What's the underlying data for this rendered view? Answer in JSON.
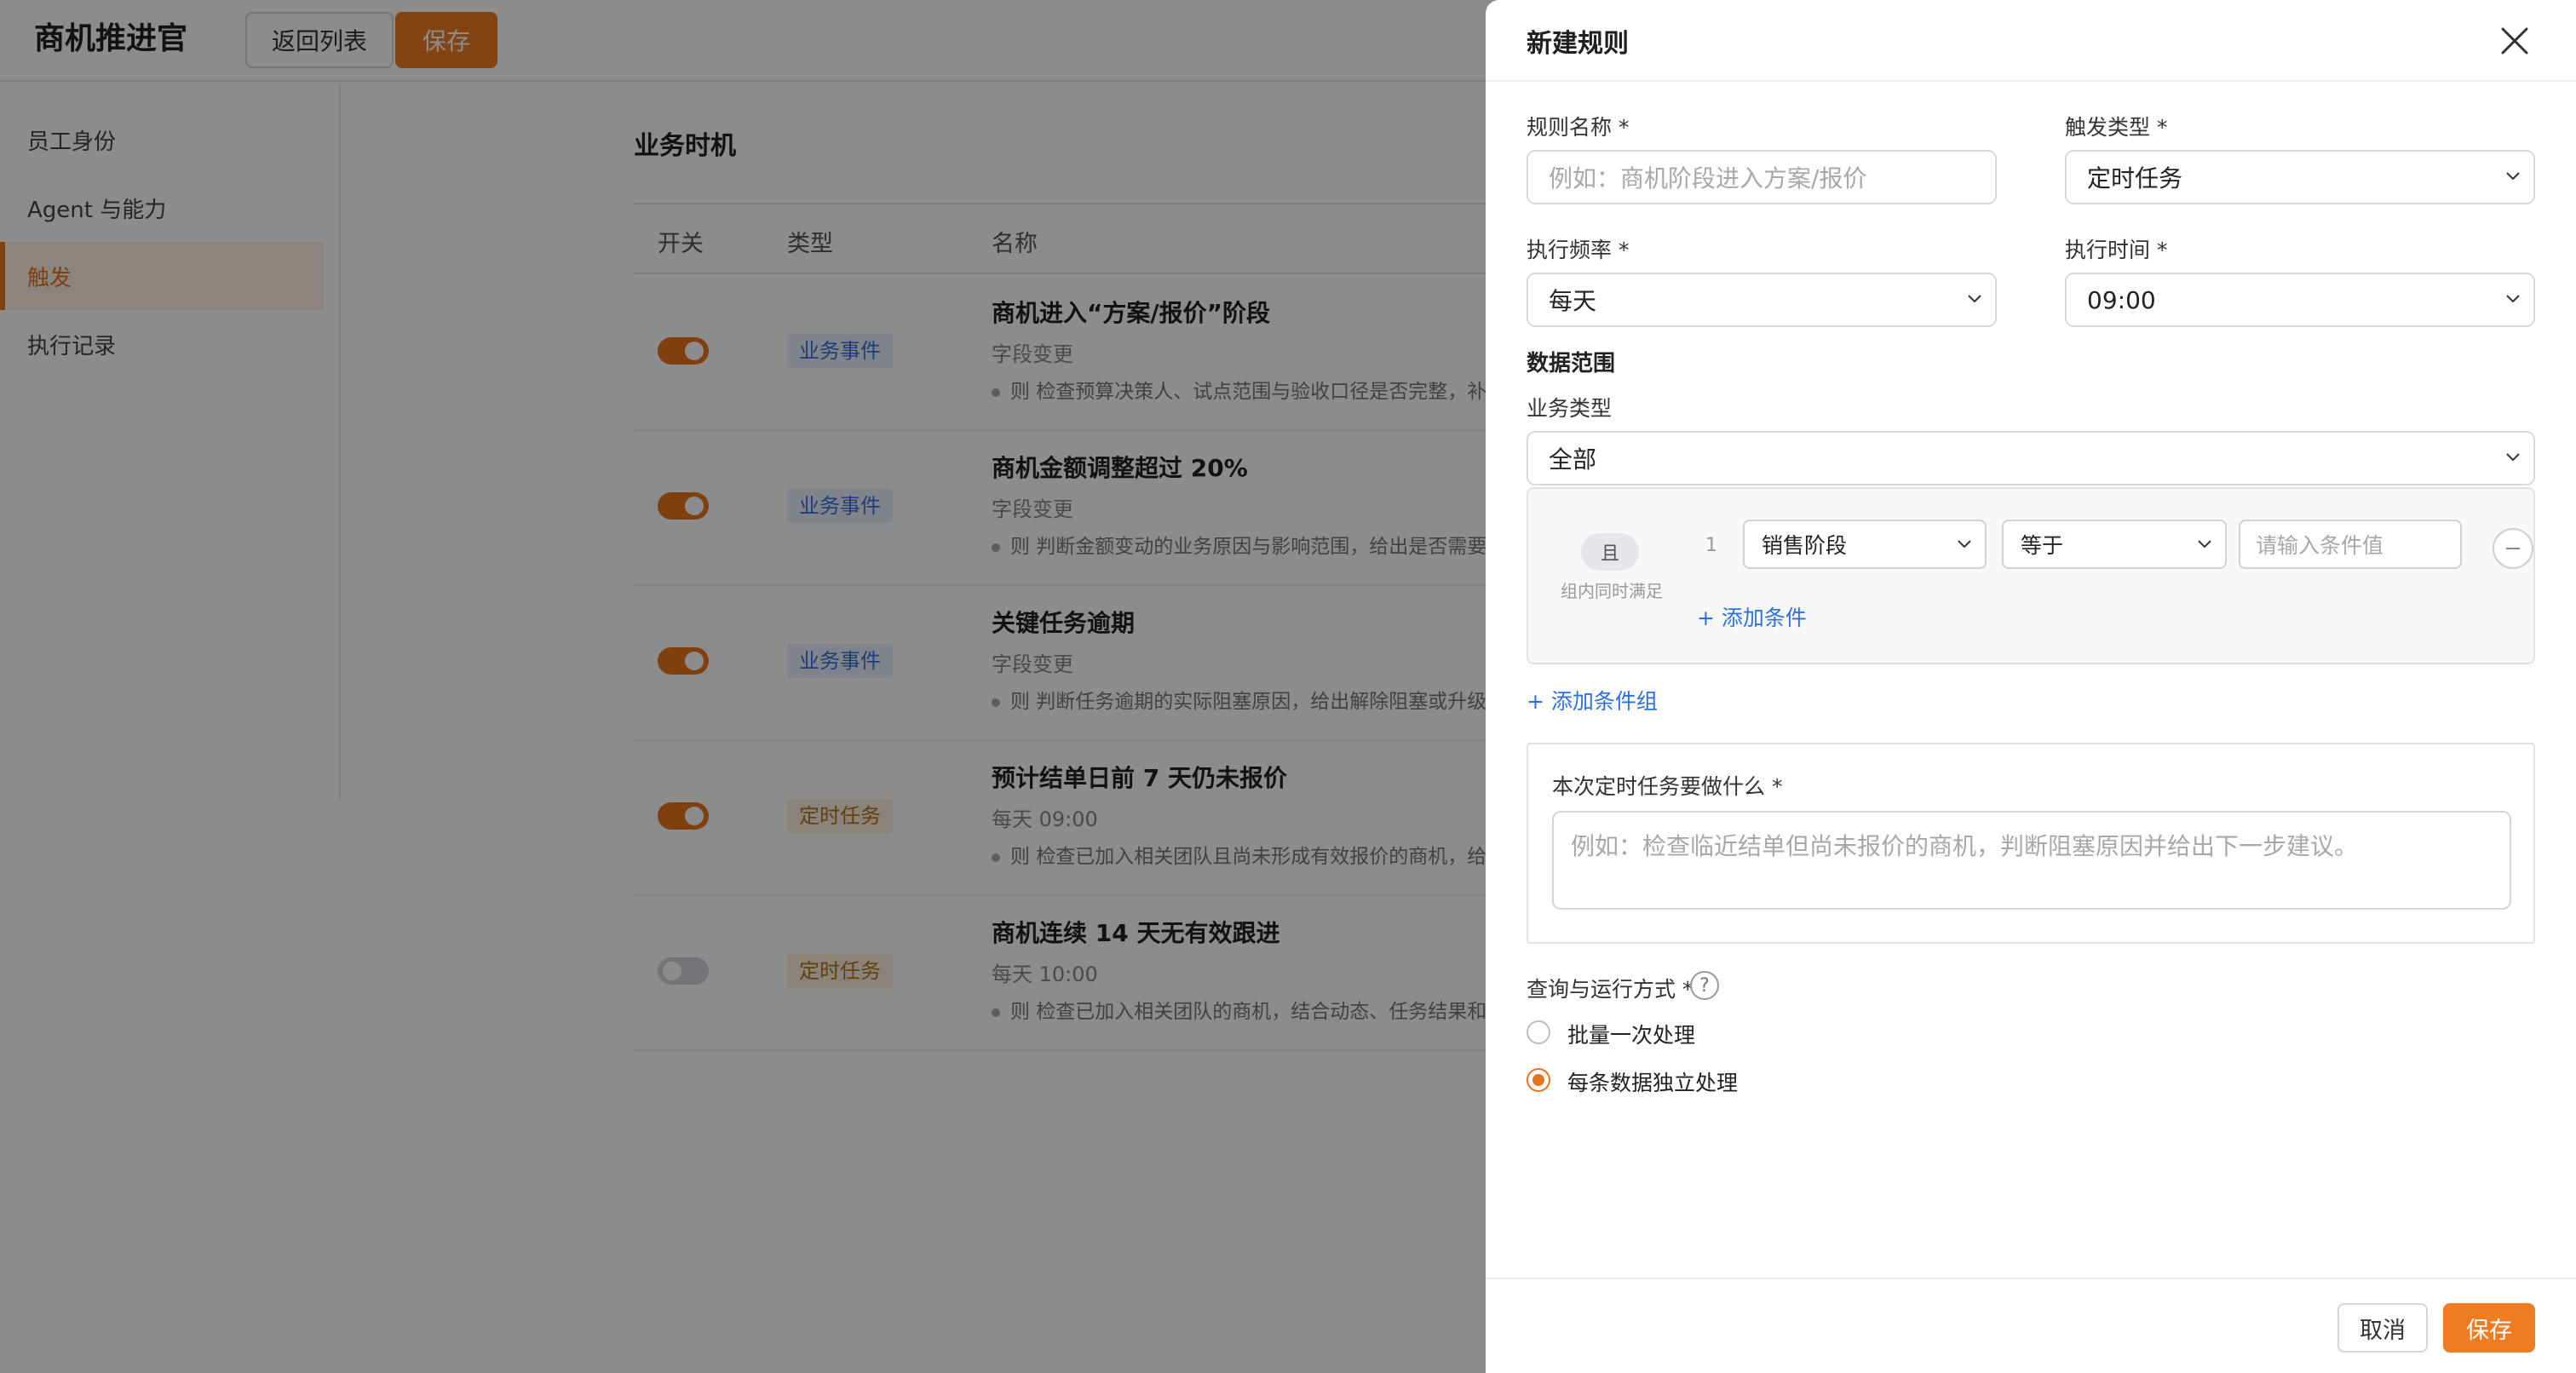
{
  "app": {
    "title": "商机推进官",
    "back_button": "返回列表",
    "save_button": "保存"
  },
  "sidebar": {
    "items": [
      {
        "label": "员工身份",
        "active": false
      },
      {
        "label": "Agent 与能力",
        "active": false
      },
      {
        "label": "触发",
        "active": true
      },
      {
        "label": "执行记录",
        "active": false
      }
    ]
  },
  "main": {
    "section_title": "业务时机",
    "columns": [
      "开关",
      "类型",
      "名称"
    ],
    "rows": [
      {
        "enabled": true,
        "type": "业务事件",
        "name": "商机进入“方案/报价”阶段",
        "sub": "字段变更",
        "desc": "则 检查预算决策人、试点范围与验收口径是否完整，补"
      },
      {
        "enabled": true,
        "type": "业务事件",
        "name": "商机金额调整超过 20%",
        "sub": "字段变更",
        "desc": "则 判断金额变动的业务原因与影响范围，给出是否需要"
      },
      {
        "enabled": true,
        "type": "业务事件",
        "name": "关键任务逾期",
        "sub": "字段变更",
        "desc": "则 判断任务逾期的实际阻塞原因，给出解除阻塞或升级"
      },
      {
        "enabled": true,
        "type": "定时任务",
        "name": "预计结单日前 7 天仍未报价",
        "sub": "每天 09:00",
        "desc": "则 检查已加入相关团队且尚未形成有效报价的商机，给"
      },
      {
        "enabled": false,
        "type": "定时任务",
        "name": "商机连续 14 天无有效跟进",
        "sub": "每天 10:00",
        "desc": "则 检查已加入相关团队的商机，结合动态、任务结果和"
      }
    ]
  },
  "drawer": {
    "title": "新建规则",
    "rule_name": {
      "label": "规则名称 *",
      "placeholder": "例如：商机阶段进入方案/报价"
    },
    "trigger_type": {
      "label": "触发类型 *",
      "value": "定时任务"
    },
    "frequency": {
      "label": "执行频率 *",
      "value": "每天"
    },
    "exec_time": {
      "label": "执行时间 *",
      "value": "09:00"
    },
    "data_scope": {
      "title": "数据范围",
      "biz_type_label": "业务类型",
      "biz_type_value": "全部",
      "group": {
        "and_label": "且",
        "and_note": "组内同时满足",
        "condition": {
          "index": "1",
          "field": "销售阶段",
          "operator": "等于",
          "value_placeholder": "请输入条件值"
        },
        "add_condition": "+ 添加条件"
      },
      "add_group": "+ 添加条件组"
    },
    "task": {
      "label": "本次定时任务要做什么 *",
      "placeholder": "例如：检查临近结单但尚未报价的商机，判断阻塞原因并给出下一步建议。"
    },
    "run_mode": {
      "label": "查询与运行方式 *",
      "help": "?",
      "options": [
        {
          "label": "批量一次处理",
          "selected": false
        },
        {
          "label": "每条数据独立处理",
          "selected": true
        }
      ]
    },
    "footer": {
      "cancel": "取消",
      "save": "保存"
    }
  },
  "colors": {
    "accent": "#f07c22",
    "link": "#2f6fe0",
    "event_tag": "#3e6fd8",
    "timer_tag": "#b6741d"
  }
}
